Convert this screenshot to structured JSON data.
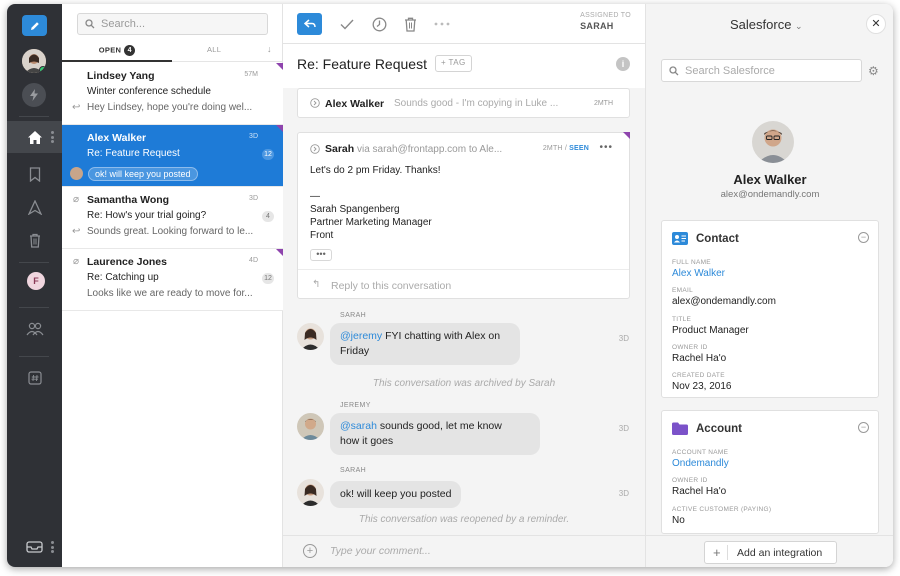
{
  "rail": {
    "profile_tag": "F"
  },
  "list": {
    "search_placeholder": "Search...",
    "tab_open": "OPEN",
    "tab_open_count": "4",
    "tab_all": "ALL",
    "conversations": [
      {
        "name": "Lindsey Yang",
        "subject": "Winter conference schedule",
        "preview": "Hey Lindsey, hope you're doing wel...",
        "time": "57M",
        "badge": ""
      },
      {
        "name": "Alex Walker",
        "subject": "Re: Feature Request",
        "preview": "ok! will keep you posted",
        "time": "3D",
        "badge": "12"
      },
      {
        "name": "Samantha Wong",
        "subject": "Re: How's your trial going?",
        "preview": "Sounds great. Looking forward to le...",
        "time": "3D",
        "badge": "4"
      },
      {
        "name": "Laurence Jones",
        "subject": "Re: Catching up",
        "preview": "Looks like we are ready to move for...",
        "time": "4D",
        "badge": "12"
      }
    ]
  },
  "main": {
    "assigned_label": "ASSIGNED TO",
    "assigned_name": "SARAH",
    "subject": "Re: Feature Request",
    "tag_button": "+ TAG",
    "collapsed_message": {
      "from": "Alex Walker",
      "snippet": "Sounds good - I'm copying in Luke ...",
      "time": "2MTH"
    },
    "open_message": {
      "from_name": "Sarah",
      "from_rest": " via sarah@frontapp.com to Ale...",
      "time": "2MTH",
      "seen": "SEEN",
      "body_line1": "Let's do 2 pm Friday. Thanks!",
      "body_line2": "—",
      "body_line3": "Sarah Spangenberg",
      "body_line4": "Partner Marketing Manager",
      "body_line5": "Front",
      "reply_placeholder": "Reply to this conversation"
    },
    "comments": [
      {
        "author": "SARAH",
        "mention": "@jeremy",
        "text": " FYI chatting with Alex on",
        "text2": "Friday",
        "time": "3D"
      },
      {
        "author": "JEREMY",
        "mention": "@sarah",
        "text": " sounds good, let me know",
        "text2": "how it goes",
        "time": "3D"
      },
      {
        "author": "SARAH",
        "mention": "",
        "text": "ok! will keep you posted",
        "text2": "",
        "time": "3D"
      }
    ],
    "system_archived": "This conversation was archived by Sarah",
    "system_reopened": "This conversation was reopened by a reminder.",
    "comment_placeholder": "Type your comment..."
  },
  "side": {
    "title": "Salesforce",
    "search_placeholder": "Search Salesforce",
    "name": "Alex Walker",
    "email": "alex@ondemandly.com",
    "contact": {
      "label": "Contact",
      "full_name_label": "FULL NAME",
      "full_name": "Alex Walker",
      "email_label": "EMAIL",
      "email": "alex@ondemandly.com",
      "title_label": "TITLE",
      "title": "Product Manager",
      "owner_label": "OWNER ID",
      "owner": "Rachel Ha'o",
      "created_label": "CREATED DATE",
      "created": "Nov 23, 2016"
    },
    "account": {
      "label": "Account",
      "account_name_label": "ACCOUNT NAME",
      "account_name": "Ondemandly",
      "owner_label": "OWNER ID",
      "owner": "Rachel Ha'o",
      "active_label": "ACTIVE CUSTOMER (PAYING)",
      "active": "No"
    },
    "add_integration": "Add an integration"
  },
  "colors": {
    "accent": "#2d8ad9",
    "rail": "#2f3136",
    "selected": "#1e7bd7",
    "tag_corner": "#8e44ad"
  }
}
